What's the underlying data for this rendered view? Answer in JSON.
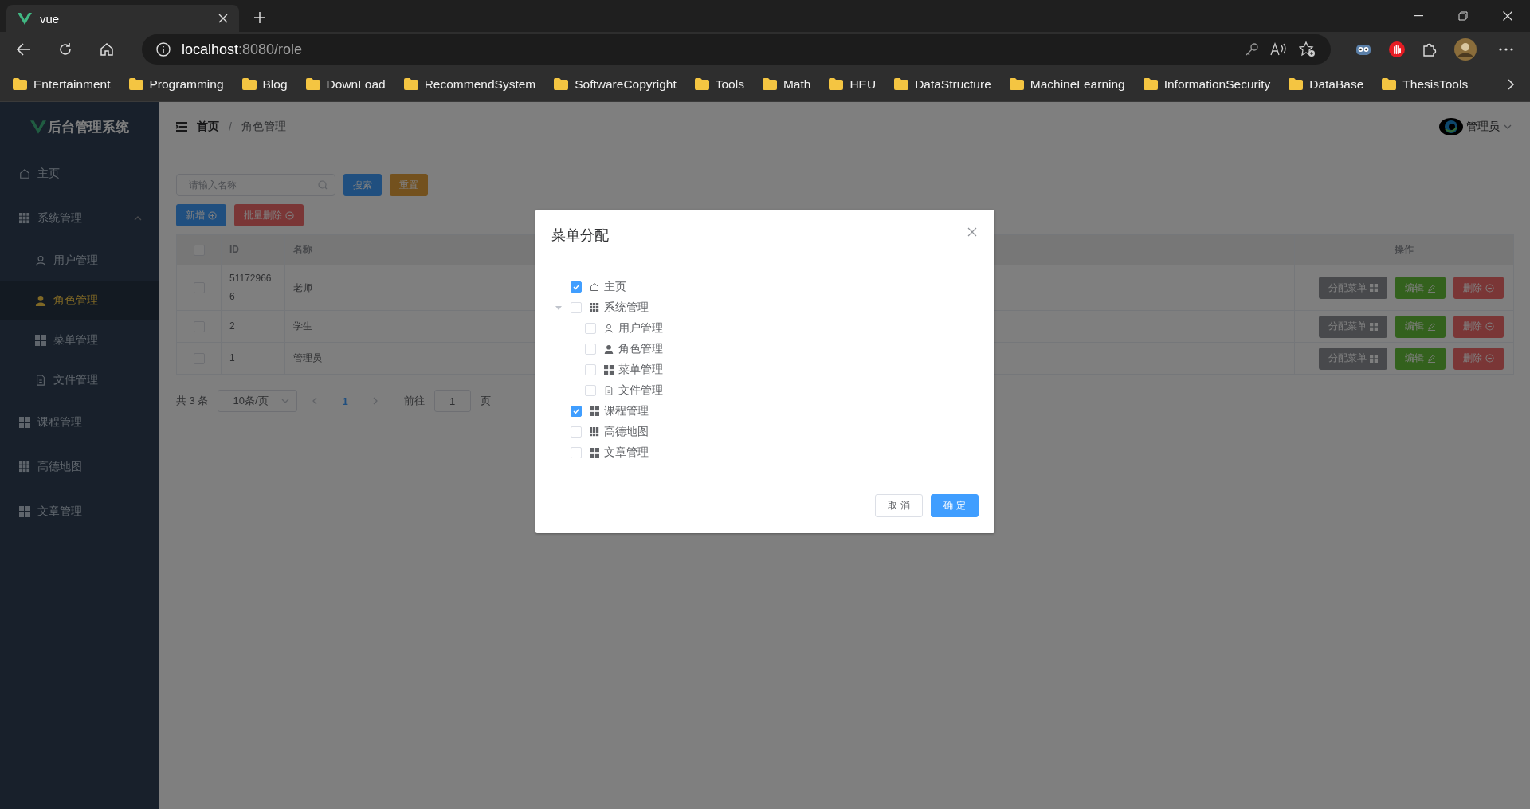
{
  "browser": {
    "tab_title": "vue",
    "url_host": "localhost",
    "url_path": ":8080/role",
    "bookmarks": [
      "Entertainment",
      "Programming",
      "Blog",
      "DownLoad",
      "RecommendSystem",
      "SoftwareCopyright",
      "Tools",
      "Math",
      "HEU",
      "DataStructure",
      "MachineLearning",
      "InformationSecurity",
      "DataBase",
      "ThesisTools"
    ]
  },
  "sidebar": {
    "logo": "后台管理系统",
    "items": [
      {
        "label": "主页",
        "kind": "home",
        "selected": false
      },
      {
        "label": "系统管理",
        "kind": "grid",
        "selected": false,
        "expanded": true,
        "children": [
          {
            "label": "用户管理",
            "kind": "user",
            "selected": false
          },
          {
            "label": "角色管理",
            "kind": "user-filled",
            "selected": true
          },
          {
            "label": "菜单管理",
            "kind": "tiles",
            "selected": false
          },
          {
            "label": "文件管理",
            "kind": "document",
            "selected": false
          }
        ]
      },
      {
        "label": "课程管理",
        "kind": "tiles",
        "selected": false
      },
      {
        "label": "高德地图",
        "kind": "grid",
        "selected": false
      },
      {
        "label": "文章管理",
        "kind": "tiles",
        "selected": false
      }
    ]
  },
  "header": {
    "breadcrumb": [
      "首页",
      "角色管理"
    ],
    "separator": "/",
    "user": "管理员"
  },
  "toolbar": {
    "search_placeholder": "请输入名称",
    "search": "搜索",
    "reset": "重置",
    "add": "新增",
    "batch_delete": "批量删除"
  },
  "table": {
    "all_checked": false,
    "columns": [
      "ID",
      "名称",
      "操作"
    ],
    "rows": [
      {
        "id": "511729666",
        "name": "老师",
        "checked": false,
        "actions": [
          "分配菜单",
          "编辑",
          "删除"
        ]
      },
      {
        "id": "2",
        "name": "学生",
        "checked": false,
        "actions": [
          "分配菜单",
          "编辑",
          "删除"
        ]
      },
      {
        "id": "1",
        "name": "管理员",
        "checked": false,
        "actions": [
          "分配菜单",
          "编辑",
          "删除"
        ]
      }
    ]
  },
  "pagination": {
    "total": "共 3 条",
    "page_size": "10条/页",
    "pages": [
      {
        "label": "1",
        "selected": true
      }
    ],
    "goto_label": "前往",
    "goto_value": "1",
    "goto_suffix": "页"
  },
  "dialog": {
    "title": "菜单分配",
    "tree": [
      {
        "label": "主页",
        "kind": "home",
        "checked": true
      },
      {
        "label": "系统管理",
        "kind": "grid",
        "checked": false,
        "expanded": true,
        "children": [
          {
            "label": "用户管理",
            "kind": "user",
            "checked": false
          },
          {
            "label": "角色管理",
            "kind": "user-filled",
            "checked": false
          },
          {
            "label": "菜单管理",
            "kind": "tiles",
            "checked": false
          },
          {
            "label": "文件管理",
            "kind": "document",
            "checked": false
          }
        ]
      },
      {
        "label": "课程管理",
        "kind": "tiles",
        "checked": true
      },
      {
        "label": "高德地图",
        "kind": "grid",
        "checked": false
      },
      {
        "label": "文章管理",
        "kind": "tiles",
        "checked": false
      }
    ],
    "cancel": "取 消",
    "confirm": "确 定"
  }
}
